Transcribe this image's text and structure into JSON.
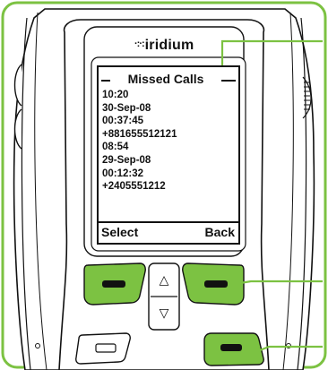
{
  "device": {
    "brand": "iridium",
    "brand_dots": "·:·:"
  },
  "screen": {
    "title": "Missed Calls",
    "calls": [
      "10:20",
      "30-Sep-08",
      "00:37:45",
      "+881655512121",
      "08:54",
      "29-Sep-08",
      "00:12:32",
      "+2405551212"
    ]
  },
  "softkeys": {
    "left": "Select",
    "right": "Back"
  },
  "keys": {
    "up_arrow": "△",
    "down_arrow": "▽"
  },
  "colors": {
    "callout_green": "#7cc242",
    "key_green": "#7cc242",
    "outline": "#111111"
  }
}
